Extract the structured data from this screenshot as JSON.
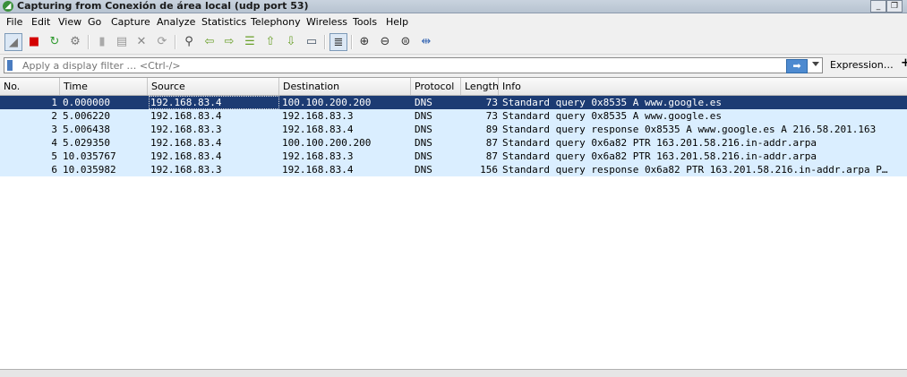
{
  "window": {
    "title": "Capturing from Conexión de área local (udp port 53)"
  },
  "menu": [
    "File",
    "Edit",
    "View",
    "Go",
    "Capture",
    "Analyze",
    "Statistics",
    "Telephony",
    "Wireless",
    "Tools",
    "Help"
  ],
  "toolbar_icons": [
    "shark-fin-start-icon",
    "stop-square-icon",
    "restart-capture-icon",
    "capture-options-icon",
    "open-file-icon",
    "save-file-icon",
    "close-file-icon",
    "reload-icon",
    "find-packet-icon",
    "go-back-icon",
    "go-forward-icon",
    "go-to-packet-icon",
    "go-first-icon",
    "go-last-icon",
    "autoscroll-icon",
    "colorize-icon",
    "zoom-in-icon",
    "zoom-out-icon",
    "zoom-normal-icon",
    "resize-columns-icon"
  ],
  "filter": {
    "placeholder": "Apply a display filter … <Ctrl-/>",
    "expression_label": "Expression…",
    "apply_glyph": "➡",
    "plus_glyph": "+"
  },
  "columns": [
    "No.",
    "Time",
    "Source",
    "Destination",
    "Protocol",
    "Length",
    "Info"
  ],
  "packets": [
    {
      "no": "1",
      "time": "0.000000",
      "src": "192.168.83.4",
      "dst": "100.100.200.200",
      "proto": "DNS",
      "len": "73",
      "info": "Standard query 0x8535 A www.google.es",
      "selected": true
    },
    {
      "no": "2",
      "time": "5.006220",
      "src": "192.168.83.4",
      "dst": "192.168.83.3",
      "proto": "DNS",
      "len": "73",
      "info": "Standard query 0x8535 A www.google.es"
    },
    {
      "no": "3",
      "time": "5.006438",
      "src": "192.168.83.3",
      "dst": "192.168.83.4",
      "proto": "DNS",
      "len": "89",
      "info": "Standard query response 0x8535 A www.google.es A 216.58.201.163"
    },
    {
      "no": "4",
      "time": "5.029350",
      "src": "192.168.83.4",
      "dst": "100.100.200.200",
      "proto": "DNS",
      "len": "87",
      "info": "Standard query 0x6a82 PTR 163.201.58.216.in-addr.arpa"
    },
    {
      "no": "5",
      "time": "10.035767",
      "src": "192.168.83.4",
      "dst": "192.168.83.3",
      "proto": "DNS",
      "len": "87",
      "info": "Standard query 0x6a82 PTR 163.201.58.216.in-addr.arpa"
    },
    {
      "no": "6",
      "time": "10.035982",
      "src": "192.168.83.3",
      "dst": "192.168.83.4",
      "proto": "DNS",
      "len": "156",
      "info": "Standard query response 0x6a82 PTR 163.201.58.216.in-addr.arpa P…"
    }
  ],
  "colors": {
    "selected_row": "#1c3b73",
    "dns_row": "#daeeff"
  }
}
